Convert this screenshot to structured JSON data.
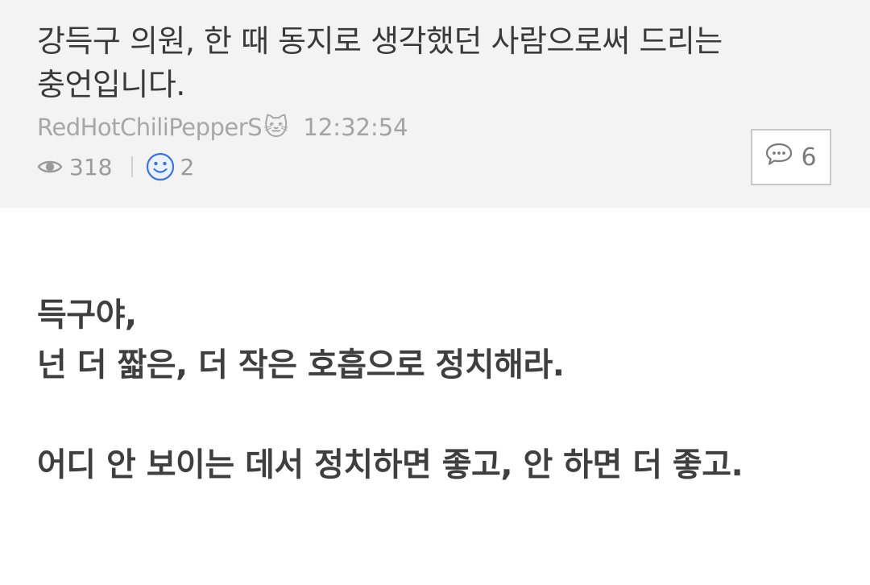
{
  "post": {
    "title": "강득구 의원, 한 때 동지로 생각했던 사람으로써 드리는 충언입니다.",
    "author": "RedHotChiliPepperS",
    "author_icon": "🐱",
    "time": "12:32:54",
    "views": "318",
    "likes": "2",
    "comments": "6",
    "body": {
      "line1": "득구야,",
      "line2": "넌 더 짧은, 더 작은 호흡으로 정치해라.",
      "line3": "어디 안 보이는 데서 정치하면 좋고, 안 하면 더 좋고."
    }
  },
  "icons": {
    "views": "eye-icon",
    "likes": "smiley-icon",
    "comments": "speech-bubble-icon"
  },
  "colors": {
    "header_background": "#f3f3f3",
    "title_text": "#3a3a3a",
    "meta_text": "#a7a7a7",
    "smiley_accent": "#3f73d8",
    "body_text": "#3f3f3f"
  }
}
